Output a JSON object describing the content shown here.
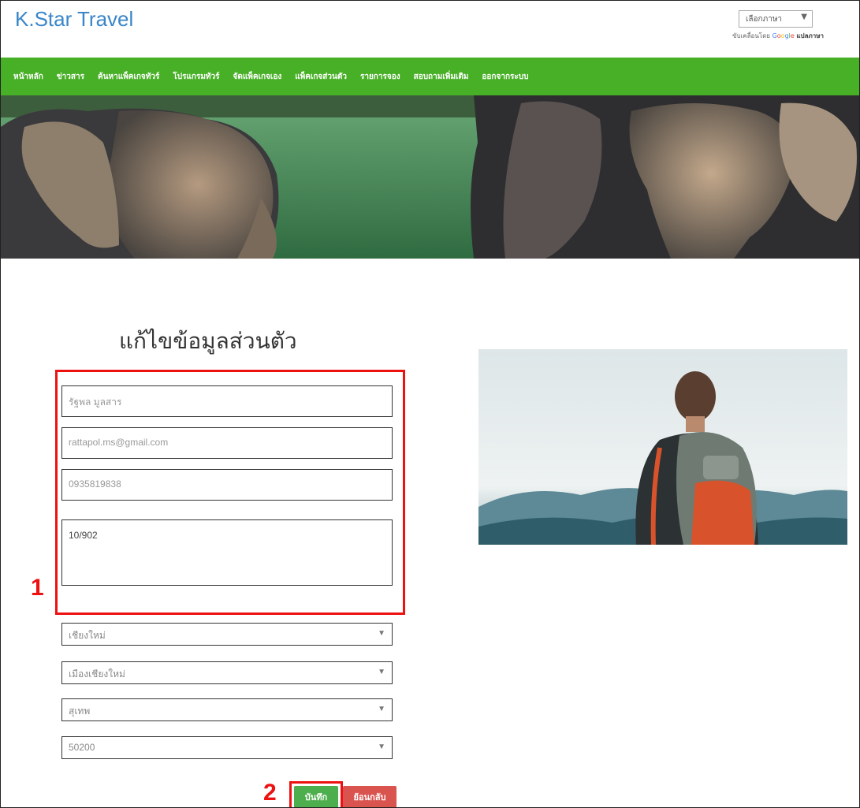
{
  "header": {
    "site_title": "K.Star Travel",
    "language_select": "เลือกภาษา",
    "powered_prefix": "ขับเคลื่อนโดย",
    "google_letters": [
      "G",
      "o",
      "o",
      "g",
      "l",
      "e"
    ],
    "translate_label": "แปลภาษา"
  },
  "nav": {
    "items": [
      "หน้าหลัก",
      "ข่าวสาร",
      "ค้นหาแพ็คเกจทัวร์",
      "โปรแกรมทัวร์",
      "จัดแพ็คเกจเอง",
      "แพ็คเกจส่วนตัว",
      "รายการจอง",
      "สอบถามเพิ่มเติม",
      "ออกจากระบบ"
    ]
  },
  "form": {
    "title": "แก้ไขข้อมูลส่วนตัว",
    "name_value": "รัฐพล มูลสาร",
    "email_value": "rattapol.ms@gmail.com",
    "phone_value": "0935819838",
    "address_value": "10/902",
    "province_value": "เชียงใหม่",
    "district_value": "เมืองเชียงใหม่",
    "subdistrict_value": "สุเทพ",
    "postcode_value": "50200",
    "save_label": "บันทึก",
    "back_label": "ย้อนกลับ"
  },
  "annotations": {
    "label_1": "1",
    "label_2": "2",
    "highlight_color": "#ee1111"
  },
  "colors": {
    "nav_bg": "#48b027",
    "title_blue": "#3a86c8",
    "save_green": "#4cae4c",
    "back_red": "#d9534f"
  }
}
